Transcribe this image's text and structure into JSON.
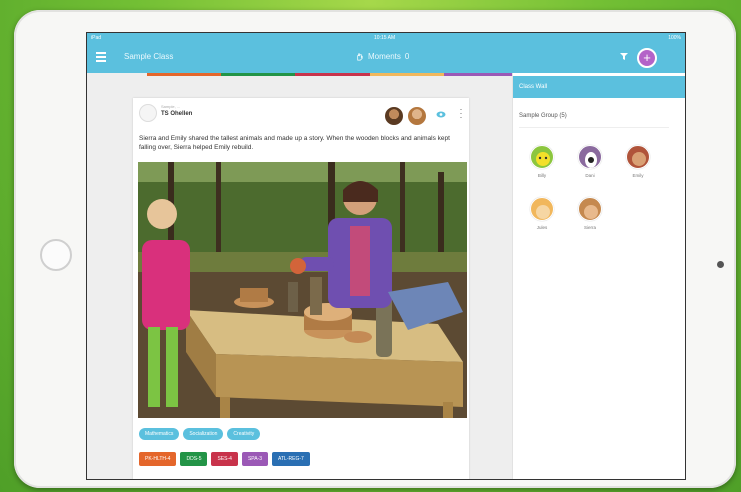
{
  "statusbar": {
    "left": "iPad",
    "time": "10:15 AM",
    "battery": "100%"
  },
  "navbar": {
    "class_name": "Sample Class",
    "center_label": "Moments",
    "center_count": "0"
  },
  "feed": {
    "timestamp": "Thursday May 22, 10:37",
    "post": {
      "meta": "Sample, ...",
      "author": "TS Ohellen",
      "caption": "Sierra and Emily shared the tallest animals and made up a story. When the wooden blocks and animals kept falling over, Sierra helped Emily rebuild.",
      "domains": [
        "Mathematics",
        "Socialization",
        "Creativity"
      ],
      "badges": [
        {
          "label": "PK-HLTH-4",
          "color": "#e4662b"
        },
        {
          "label": "DDS-5",
          "color": "#239447"
        },
        {
          "label": "SES-4",
          "color": "#c8334b"
        },
        {
          "label": "SPA-3",
          "color": "#9b59b6"
        },
        {
          "label": "ATL-REG-7",
          "color": "#2a6fb3"
        }
      ]
    }
  },
  "sidebar": {
    "header": "Class Wall",
    "group_label": "Sample Group (5)",
    "students": [
      {
        "name": "Billy",
        "color": "#8cc63e"
      },
      {
        "name": "Dani",
        "color": "#8a6a9e"
      },
      {
        "name": "Emily",
        "color": "#b0543a"
      },
      {
        "name": "Jules",
        "color": "#f1b75c"
      },
      {
        "name": "Sierra",
        "color": "#c5894f"
      }
    ]
  },
  "colors": {
    "accent": "#5bc0de",
    "add_button": "#b463c8",
    "background": "#5fb52e"
  }
}
